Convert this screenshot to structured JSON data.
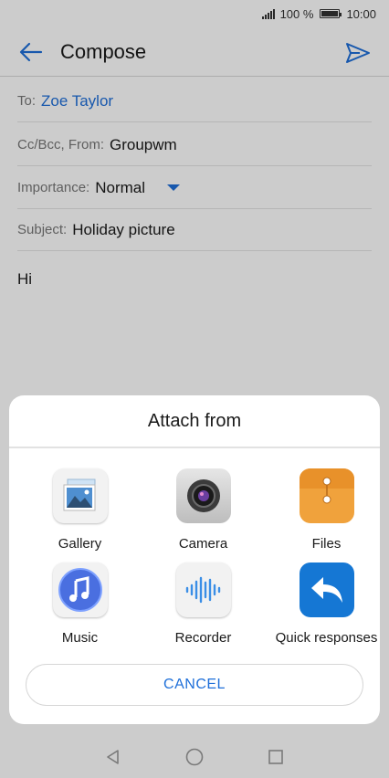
{
  "status": {
    "battery": "100 %",
    "time": "10:00"
  },
  "header": {
    "title": "Compose"
  },
  "fields": {
    "to_label": "To:",
    "to_value": "Zoe Taylor",
    "cc_label": "Cc/Bcc, From:",
    "cc_value": "Groupwm",
    "importance_label": "Importance:",
    "importance_value": "Normal",
    "subject_label": "Subject:",
    "subject_value": "Holiday picture"
  },
  "body": "Hi",
  "sheet": {
    "title": "Attach from",
    "options": [
      {
        "label": "Gallery",
        "icon": "gallery-icon"
      },
      {
        "label": "Camera",
        "icon": "camera-icon"
      },
      {
        "label": "Files",
        "icon": "files-icon"
      },
      {
        "label": "Music",
        "icon": "music-icon"
      },
      {
        "label": "Recorder",
        "icon": "recorder-icon"
      },
      {
        "label": "Quick responses",
        "icon": "quick-responses-icon"
      }
    ],
    "cancel": "CANCEL"
  },
  "colors": {
    "accent": "#1e6fd9",
    "files_orange": "#f0a23c"
  }
}
